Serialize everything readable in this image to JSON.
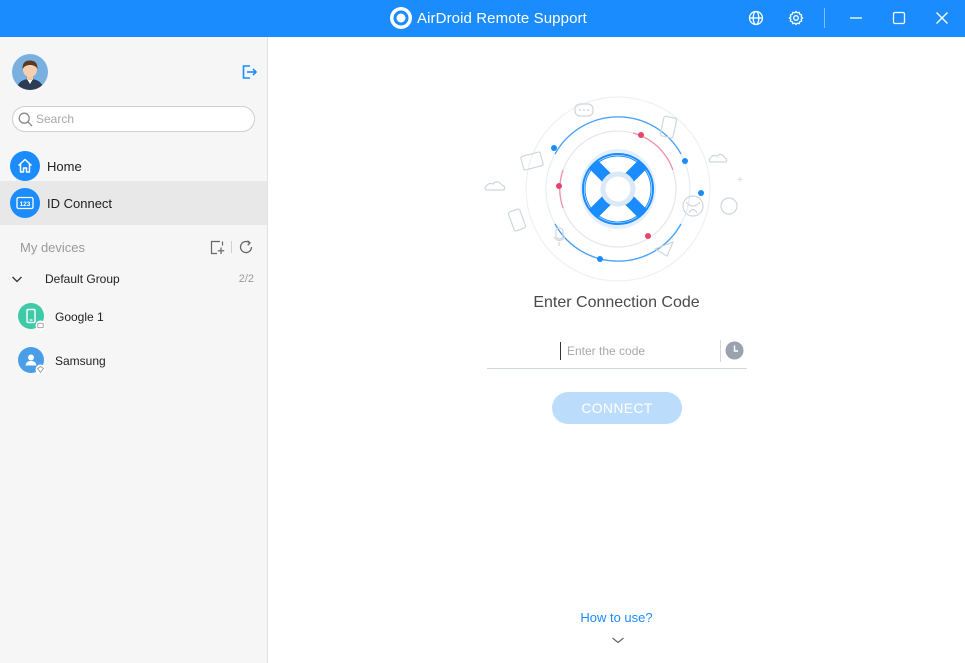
{
  "window": {
    "title": "AirDroid Remote Support"
  },
  "colors": {
    "accent": "#1a8cfe",
    "connect_disabled": "#bcdcfb",
    "sidebar_bg": "#f6f6f6",
    "active_item": "#e8e8e8"
  },
  "titlebar": {
    "icons": [
      "globe-icon",
      "gear-icon",
      "minimize-icon",
      "maximize-icon",
      "close-icon"
    ]
  },
  "sidebar": {
    "search_placeholder": "Search",
    "nav": [
      {
        "label": "Home",
        "icon": "home-icon",
        "active": false
      },
      {
        "label": "ID Connect",
        "icon": "id-connect-icon",
        "active": true
      }
    ],
    "devices_section": {
      "label": "My devices",
      "group": {
        "name": "Default Group",
        "count": "2/2",
        "devices": [
          {
            "name": "Google 1",
            "icon": "android-phone-icon",
            "color": "#3ec9a7"
          },
          {
            "name": "Samsung",
            "icon": "user-device-icon",
            "color": "#4a9ee8"
          }
        ]
      }
    }
  },
  "main": {
    "heading": "Enter Connection Code",
    "code_placeholder": "Enter the code",
    "connect_label": "CONNECT",
    "help_link": "How to use?"
  }
}
